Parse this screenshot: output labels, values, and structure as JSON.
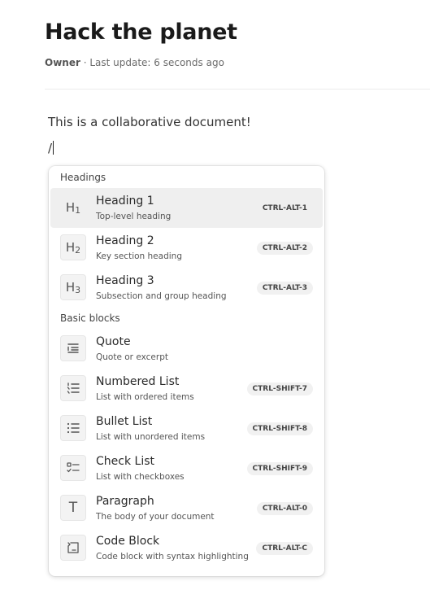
{
  "document": {
    "title": "Hack the planet",
    "owner": "Owner",
    "last_update": " · Last update: 6 seconds ago",
    "paragraph": "This is a collaborative document!",
    "slash_input": "/"
  },
  "menu": {
    "groups": [
      {
        "label": "Headings",
        "items": [
          {
            "title": "Heading 1",
            "description": "Top-level heading",
            "shortcut": "CTRL-ALT-1",
            "icon": "heading-1-icon",
            "glyph": "H",
            "glyph_sub": "1",
            "active": true
          },
          {
            "title": "Heading 2",
            "description": "Key section heading",
            "shortcut": "CTRL-ALT-2",
            "icon": "heading-2-icon",
            "glyph": "H",
            "glyph_sub": "2"
          },
          {
            "title": "Heading 3",
            "description": "Subsection and group heading",
            "shortcut": "CTRL-ALT-3",
            "icon": "heading-3-icon",
            "glyph": "H",
            "glyph_sub": "3"
          }
        ]
      },
      {
        "label": "Basic blocks",
        "items": [
          {
            "title": "Quote",
            "description": "Quote or excerpt",
            "shortcut": "",
            "icon": "quote-icon"
          },
          {
            "title": "Numbered List",
            "description": "List with ordered items",
            "shortcut": "CTRL-SHIFT-7",
            "icon": "numbered-list-icon"
          },
          {
            "title": "Bullet List",
            "description": "List with unordered items",
            "shortcut": "CTRL-SHIFT-8",
            "icon": "bullet-list-icon"
          },
          {
            "title": "Check List",
            "description": "List with checkboxes",
            "shortcut": "CTRL-SHIFT-9",
            "icon": "check-list-icon"
          },
          {
            "title": "Paragraph",
            "description": "The body of your document",
            "shortcut": "CTRL-ALT-0",
            "icon": "paragraph-icon",
            "glyph": "T"
          },
          {
            "title": "Code Block",
            "description": "Code block with syntax highlighting",
            "shortcut": "CTRL-ALT-C",
            "icon": "code-block-icon"
          }
        ]
      }
    ]
  }
}
